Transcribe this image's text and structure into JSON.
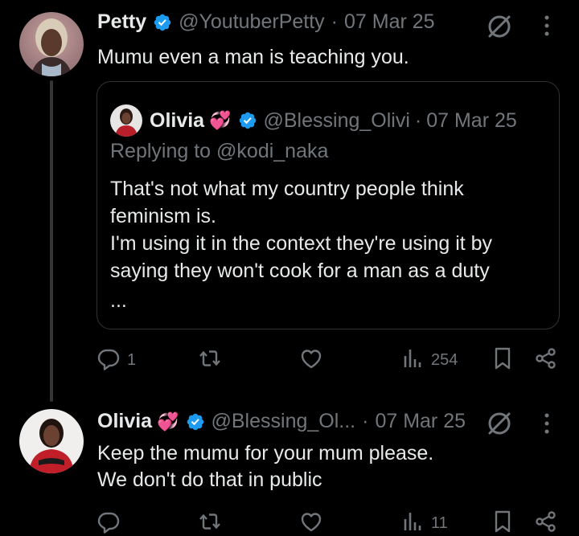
{
  "tweet1": {
    "name": "Petty",
    "handle": "@YoutuberPetty",
    "separator": "·",
    "date": "07 Mar 25",
    "text": "Mumu even a man is teaching you.",
    "quote": {
      "name": "Olivia",
      "emoji": "💞",
      "handle": "@Blessing_Olivi",
      "separator": "·",
      "date": "07 Mar 25",
      "replying_prefix": "Replying to ",
      "replying_handle": "@kodi_naka",
      "text": "That's not what my country people think feminism is.\nI'm using it in the context they're using it by saying they won't cook for a man as a duty",
      "ellipsis": "..."
    },
    "actions": {
      "replies": "1",
      "reposts": "",
      "likes": "",
      "views": "254"
    }
  },
  "tweet2": {
    "name": "Olivia",
    "emoji": "💞",
    "handle": "@Blessing_Ol...",
    "separator": "·",
    "date": "07 Mar 25",
    "text": "Keep the mumu for your mum please.\nWe don't do that in public",
    "actions": {
      "replies": "",
      "reposts": "",
      "likes": "",
      "views": "11"
    }
  },
  "colors": {
    "background": "#000000",
    "text": "#e7e9ea",
    "muted": "#71767b",
    "verified": "#1d9bf0",
    "border": "#2f3336"
  },
  "icons": [
    "verified-badge-icon",
    "grok-icon",
    "more-icon",
    "reply-icon",
    "repost-icon",
    "like-icon",
    "views-icon",
    "bookmark-icon",
    "share-icon"
  ]
}
